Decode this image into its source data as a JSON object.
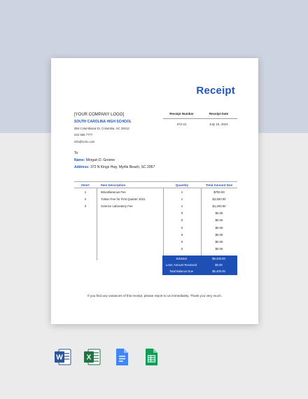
{
  "document": {
    "title": "Receipt",
    "company": {
      "logo_placeholder": "[YOUR COMPANY LOGO]",
      "name": "SOUTH CAROLINA HIGH SCHOOL",
      "address": "384 Columbiana Dr, Columbia, SC 29212",
      "phone": "222 555 7777",
      "email": "info@schc.com"
    },
    "meta": {
      "receipt_number_label": "Receipt Number",
      "receipt_date_label": "Receipt Date",
      "receipt_number": "372-21",
      "receipt_date": "July 15, 2021"
    },
    "to": {
      "label": "To",
      "name_label": "Name:",
      "name": "Morgan D. Greene",
      "address_label": "Address:",
      "address": "372 N Kings Hwy, Myrtle Beach, SC 2957"
    },
    "table": {
      "headers": {
        "item": "Item#",
        "description": "Item Description",
        "quantity": "Quantity",
        "total": "Total Amount Due"
      },
      "rows": [
        {
          "item": "1",
          "description": "Miscellaneous Fee",
          "quantity": "1",
          "total": "$700.00"
        },
        {
          "item": "2",
          "description": "Tuition Fee for First Quarter 2021",
          "quantity": "1",
          "total": "$4,500.00"
        },
        {
          "item": "3",
          "description": "Science Laboratory Fee",
          "quantity": "1",
          "total": "$1,200.00"
        },
        {
          "item": "",
          "description": "",
          "quantity": "0",
          "total": "$0.00"
        },
        {
          "item": "",
          "description": "",
          "quantity": "0",
          "total": "$0.00"
        },
        {
          "item": "",
          "description": "",
          "quantity": "0",
          "total": "$0.00"
        },
        {
          "item": "",
          "description": "",
          "quantity": "0",
          "total": "$0.00"
        },
        {
          "item": "",
          "description": "",
          "quantity": "0",
          "total": "$0.00"
        },
        {
          "item": "",
          "description": "",
          "quantity": "0",
          "total": "$0.00"
        }
      ],
      "summary": [
        {
          "label": "Subtotal",
          "value": "$6,400.00"
        },
        {
          "label": "Less: Amount Received",
          "value": "$0.00"
        },
        {
          "label": "Total Balance Due",
          "value": "$6,400.00"
        }
      ]
    },
    "footer_note": "If you find any variances of this receipt, please report to us immediately. Thank you very much."
  },
  "app_icons": [
    {
      "name": "word-icon",
      "color": "#2b579a"
    },
    {
      "name": "excel-icon",
      "color": "#217346"
    },
    {
      "name": "google-docs-icon",
      "color": "#4285f4"
    },
    {
      "name": "google-sheets-icon",
      "color": "#0f9d58"
    }
  ]
}
